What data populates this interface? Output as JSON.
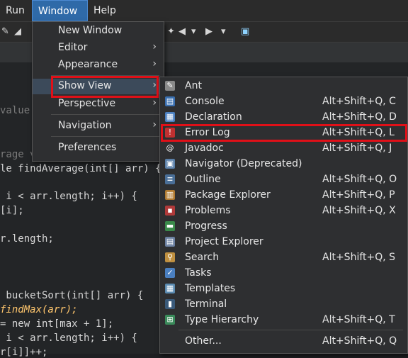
{
  "menubar": {
    "items": [
      {
        "label": "Run"
      },
      {
        "label": "Window"
      },
      {
        "label": "Help"
      }
    ]
  },
  "code_lines": [
    {
      "text": "value",
      "class": "cmt"
    },
    {
      "text": "rage v",
      "class": "cmt"
    },
    {
      "text": "le findAverage(int[] arr) {"
    },
    {
      "text": " i < arr.length; i++) {"
    },
    {
      "text": "[i];"
    },
    {
      "text": "r.length;"
    },
    {
      "text": " bucketSort(int[] arr) {"
    },
    {
      "text": "findMax(arr);"
    },
    {
      "text": "= new int[max + 1];"
    },
    {
      "text": " i < arr.length; i++) {"
    },
    {
      "text": "r[i]]++;"
    }
  ],
  "window_menu": {
    "items": [
      {
        "label": "New Window",
        "submenu": false
      },
      {
        "label": "Editor",
        "submenu": true
      },
      {
        "label": "Appearance",
        "submenu": true
      },
      {
        "label": "Show View",
        "submenu": true
      },
      {
        "label": "Perspective",
        "submenu": true
      },
      {
        "label": "Navigation",
        "submenu": true
      },
      {
        "label": "Preferences",
        "submenu": false
      }
    ],
    "arrow": "›"
  },
  "show_view_menu": {
    "items": [
      {
        "label": "Ant",
        "shortcut": "",
        "icon": "ant-icon",
        "color": "#8a8a8a",
        "glyph": "✎"
      },
      {
        "label": "Console",
        "shortcut": "Alt+Shift+Q, C",
        "icon": "console-icon",
        "color": "#3a6fb0",
        "glyph": "▤"
      },
      {
        "label": "Declaration",
        "shortcut": "Alt+Shift+Q, D",
        "icon": "declaration-icon",
        "color": "#4a7fc0",
        "glyph": "▦"
      },
      {
        "label": "Error Log",
        "shortcut": "Alt+Shift+Q, L",
        "icon": "error-log-icon",
        "color": "#c03030",
        "glyph": "!"
      },
      {
        "label": "Javadoc",
        "shortcut": "Alt+Shift+Q, J",
        "icon": "javadoc-icon",
        "color": "#2e2f31",
        "glyph": "@"
      },
      {
        "label": "Navigator (Deprecated)",
        "shortcut": "",
        "icon": "navigator-icon",
        "color": "#5a7fa8",
        "glyph": "▣"
      },
      {
        "label": "Outline",
        "shortcut": "Alt+Shift+Q, O",
        "icon": "outline-icon",
        "color": "#4a6f98",
        "glyph": "≡"
      },
      {
        "label": "Package Explorer",
        "shortcut": "Alt+Shift+Q, P",
        "icon": "package-explorer-icon",
        "color": "#b07a30",
        "glyph": "▥"
      },
      {
        "label": "Problems",
        "shortcut": "Alt+Shift+Q, X",
        "icon": "problems-icon",
        "color": "#b03a3a",
        "glyph": "▪"
      },
      {
        "label": "Progress",
        "shortcut": "",
        "icon": "progress-icon",
        "color": "#3a8a4a",
        "glyph": "▬"
      },
      {
        "label": "Project Explorer",
        "shortcut": "",
        "icon": "project-explorer-icon",
        "color": "#6a7fa0",
        "glyph": "▤"
      },
      {
        "label": "Search",
        "shortcut": "Alt+Shift+Q, S",
        "icon": "search-icon",
        "color": "#c09040",
        "glyph": "⚲"
      },
      {
        "label": "Tasks",
        "shortcut": "",
        "icon": "tasks-icon",
        "color": "#4a7fc0",
        "glyph": "✓"
      },
      {
        "label": "Templates",
        "shortcut": "",
        "icon": "templates-icon",
        "color": "#5a8ab0",
        "glyph": "▦"
      },
      {
        "label": "Terminal",
        "shortcut": "",
        "icon": "terminal-icon",
        "color": "#3a5a7a",
        "glyph": "▮"
      },
      {
        "label": "Type Hierarchy",
        "shortcut": "Alt+Shift+Q, T",
        "icon": "type-hierarchy-icon",
        "color": "#3a8a5a",
        "glyph": "⊞"
      },
      {
        "label": "Other...",
        "shortcut": "Alt+Shift+Q, Q",
        "icon": "",
        "color": "",
        "glyph": ""
      }
    ]
  },
  "colors": {
    "menu_bg": "#2e2f31",
    "highlight_box": "#e01018",
    "active_menu": "#2f6aa8"
  }
}
